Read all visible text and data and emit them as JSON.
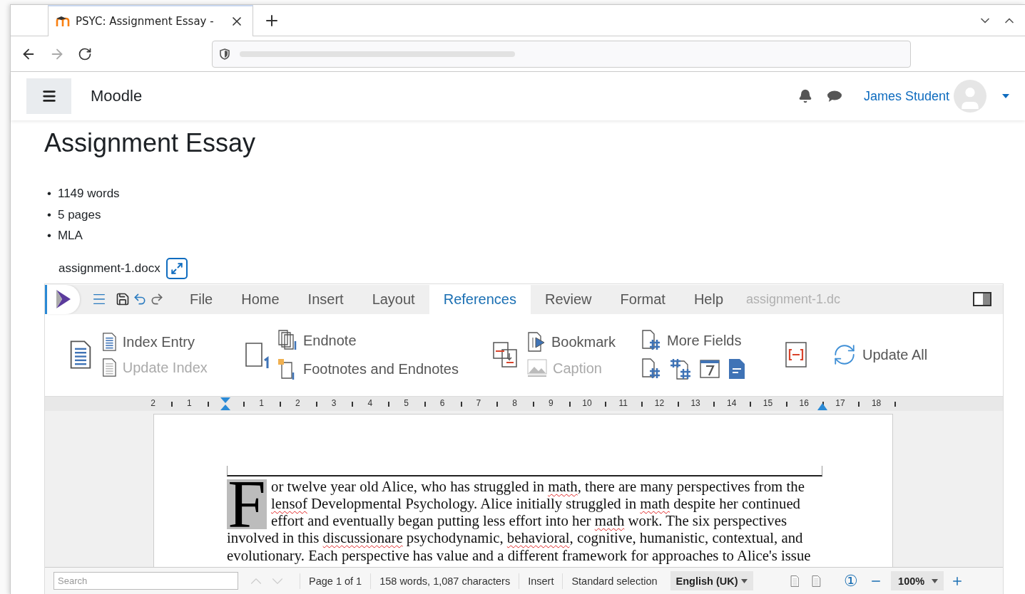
{
  "browser": {
    "tab_title": "PSYC: Assignment Essay -"
  },
  "site": {
    "name": "Moodle",
    "user": "James Student"
  },
  "page": {
    "title": "Assignment Essay",
    "details": [
      {
        "marker": "•",
        "text": "1149 words"
      },
      {
        "marker": "•",
        "text": "5 pages"
      },
      {
        "marker": "•",
        "text": "MLA"
      }
    ],
    "file": "assignment-1.docx"
  },
  "editor": {
    "menu": [
      {
        "label": "File",
        "selected": false
      },
      {
        "label": "Home",
        "selected": false
      },
      {
        "label": "Insert",
        "selected": false
      },
      {
        "label": "Layout",
        "selected": false
      },
      {
        "label": "References",
        "selected": true
      },
      {
        "label": "Review",
        "selected": false
      },
      {
        "label": "Format",
        "selected": false
      },
      {
        "label": "Help",
        "selected": false
      }
    ],
    "document_name": "assignment-1.dc",
    "ribbon_items": [
      {
        "label": "Index Entry",
        "disabled": false
      },
      {
        "label": "Update Index",
        "disabled": true
      },
      {
        "label": "Endnote",
        "disabled": false
      },
      {
        "label": "Footnotes and Endnotes",
        "disabled": false
      },
      {
        "label": "Bookmark",
        "disabled": false
      },
      {
        "label": "Caption",
        "disabled": true
      },
      {
        "label": "More Fields",
        "disabled": false
      },
      {
        "label": "Update All",
        "disabled": false
      }
    ],
    "ruler": [
      "2",
      "1",
      "1",
      "2",
      "3",
      "4",
      "5",
      "6",
      "7",
      "8",
      "9",
      "10",
      "11",
      "12",
      "13",
      "14",
      "15",
      "16",
      "17",
      "18"
    ],
    "document": {
      "drop_cap": "F",
      "segments": [
        {
          "text": "or twelve year old Alice, who has struggled in ",
          "misspelled": false
        },
        {
          "text": "math",
          "misspelled": true
        },
        {
          "text": ", there are many perspectives from the ",
          "misspelled": false
        },
        {
          "text": "lensof",
          "misspelled": true
        },
        {
          "text": " Developmental Psychology. Alice initially struggled in ",
          "misspelled": false
        },
        {
          "text": "math",
          "misspelled": true
        },
        {
          "text": " despite her continued effort and eventually began putting less effort into her ",
          "misspelled": false
        },
        {
          "text": "math",
          "misspelled": true
        },
        {
          "text": " work. The six perspectives involved in this ",
          "misspelled": false
        },
        {
          "text": "discussionare",
          "misspelled": true
        },
        {
          "text": " psychodynamic, ",
          "misspelled": false
        },
        {
          "text": "behavioral",
          "misspelled": true
        },
        {
          "text": ", cognitive, humanistic, contextual, and evolutionary. Each perspective has value and a different framework for approaches to Alice's issue",
          "misspelled": false
        }
      ]
    },
    "status": {
      "search_placeholder": "Search",
      "page": "Page 1 of 1",
      "counts": "158 words, 1,087 characters",
      "mode": "Insert",
      "selection": "Standard selection",
      "language": "English (UK)",
      "view_glyph": "①",
      "zoom": "100%"
    }
  }
}
